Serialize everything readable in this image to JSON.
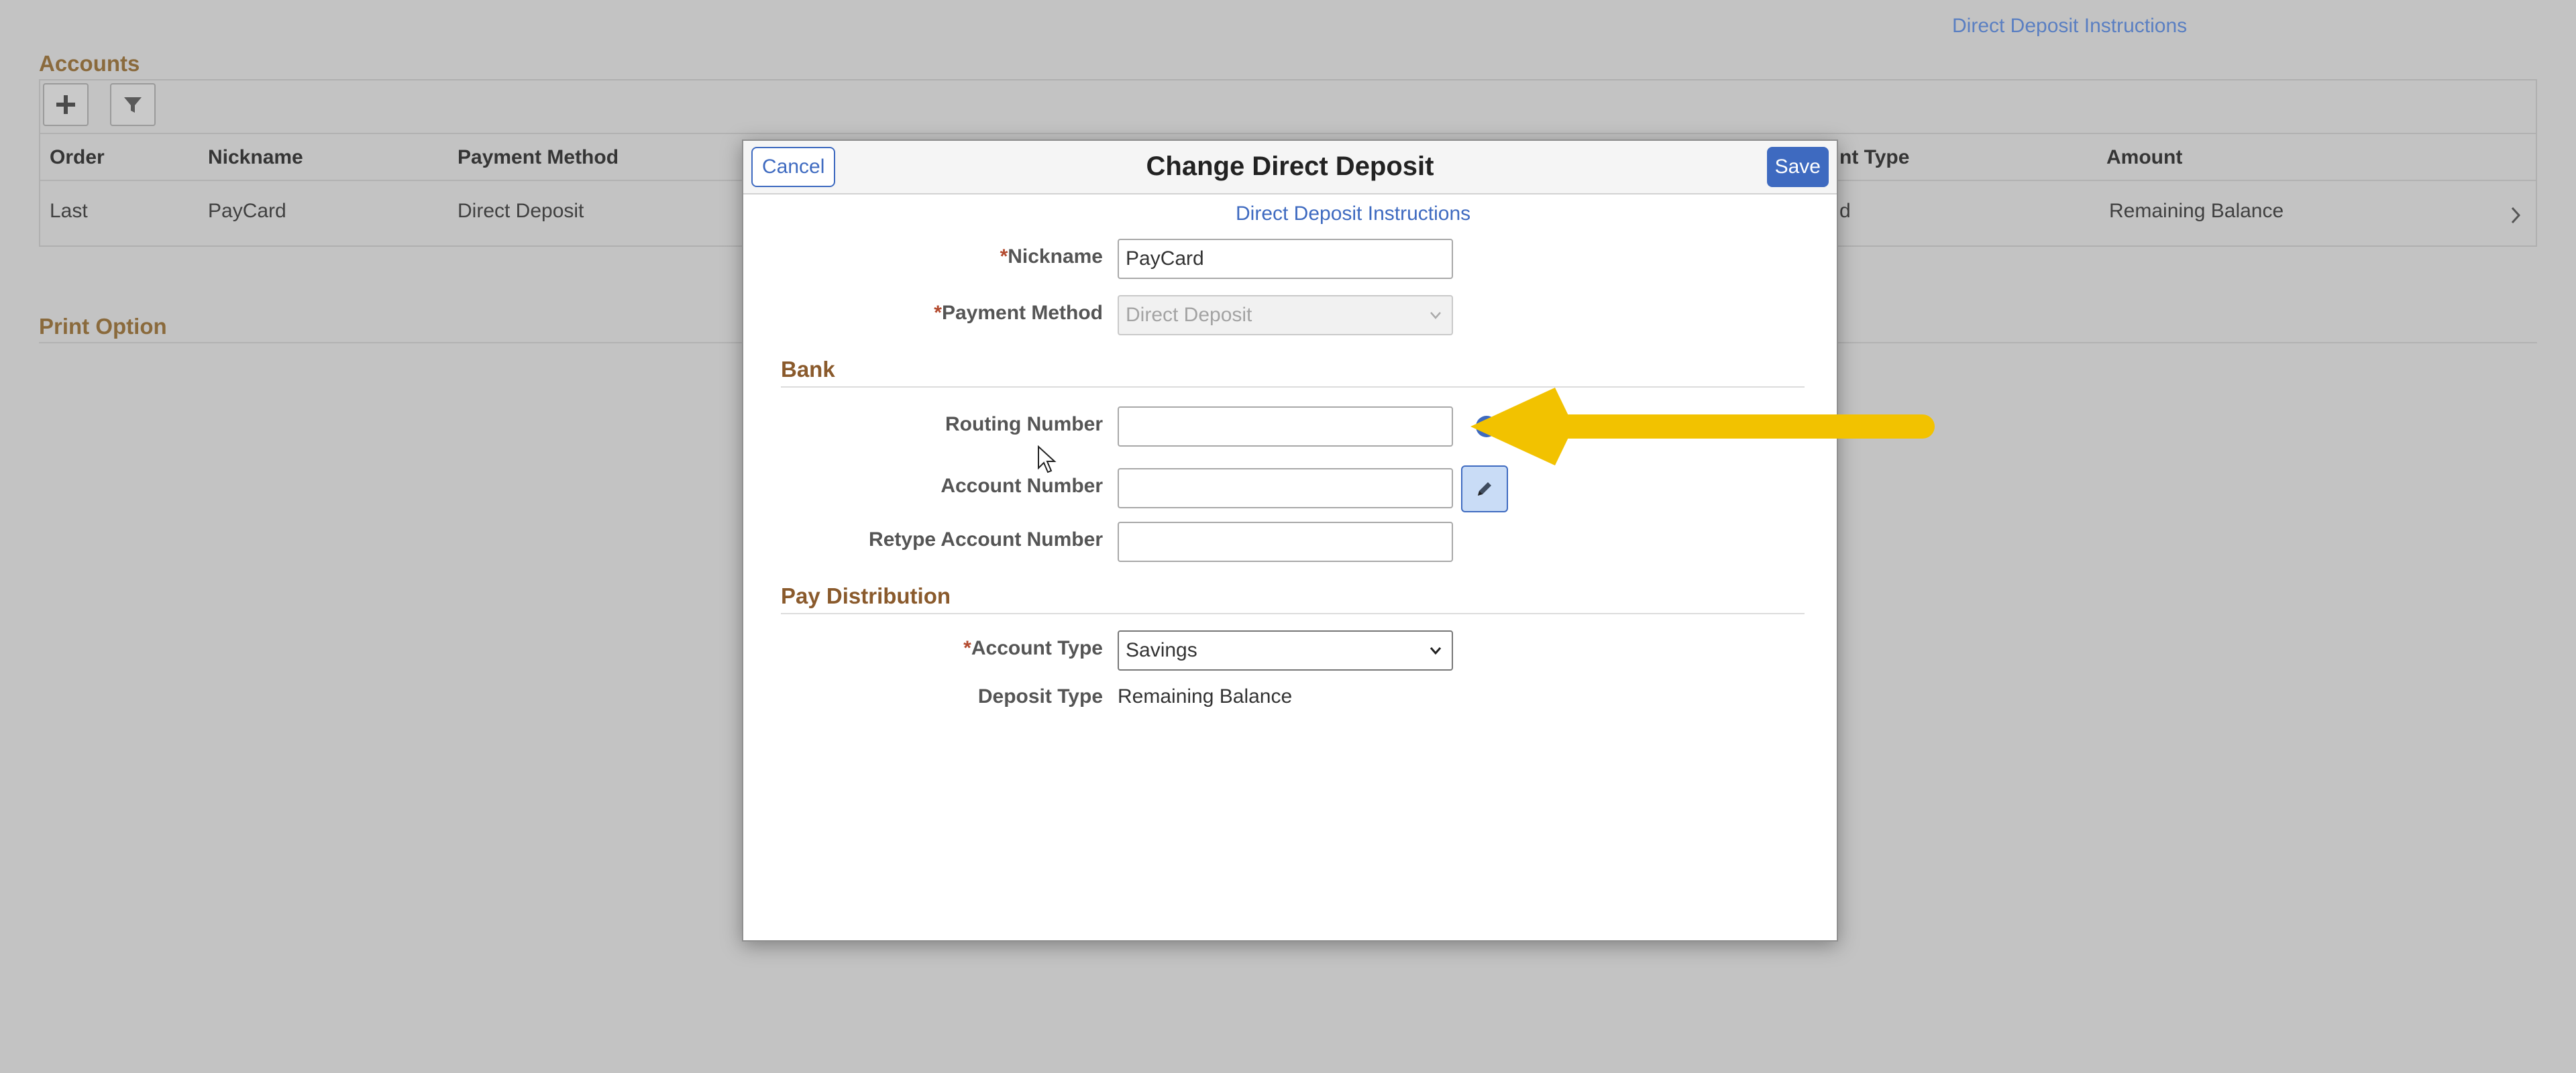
{
  "background": {
    "instructions_link": "Direct Deposit Instructions",
    "accounts_title": "Accounts",
    "toolbar": {
      "add_icon": "plus-icon",
      "filter_icon": "filter-icon"
    },
    "columns": [
      "Order",
      "Nickname",
      "Payment Method",
      "nt Type",
      "Amount"
    ],
    "row": {
      "order": "Last",
      "nickname": "PayCard",
      "payment_method": "Direct Deposit",
      "account_type": "d",
      "amount": "Remaining Balance"
    },
    "print_option_title": "Print Option"
  },
  "modal": {
    "title": "Change Direct Deposit",
    "cancel_label": "Cancel",
    "save_label": "Save",
    "instructions_link": "Direct Deposit Instructions",
    "required_marker": "*",
    "nickname": {
      "label": "Nickname",
      "value": "PayCard"
    },
    "payment_method": {
      "label": "Payment Method",
      "value": "Direct Deposit",
      "disabled": true
    },
    "bank_section": "Bank",
    "routing_number": {
      "label": "Routing Number",
      "value": ""
    },
    "account_number": {
      "label": "Account Number",
      "value": "",
      "edit_icon": "pencil-icon"
    },
    "retype_account_number": {
      "label": "Retype Account Number",
      "value": ""
    },
    "pay_distribution_section": "Pay Distribution",
    "account_type": {
      "label": "Account Type",
      "value": "Savings"
    },
    "deposit_type": {
      "label": "Deposit Type",
      "value": "Remaining Balance"
    }
  },
  "annotation": {
    "arrow_color": "#f2c200",
    "points_to": "info-icon"
  },
  "colors": {
    "accent": "#3e6ac0",
    "section_title": "#8a5a2c",
    "overlay": "#c3c3c3"
  }
}
